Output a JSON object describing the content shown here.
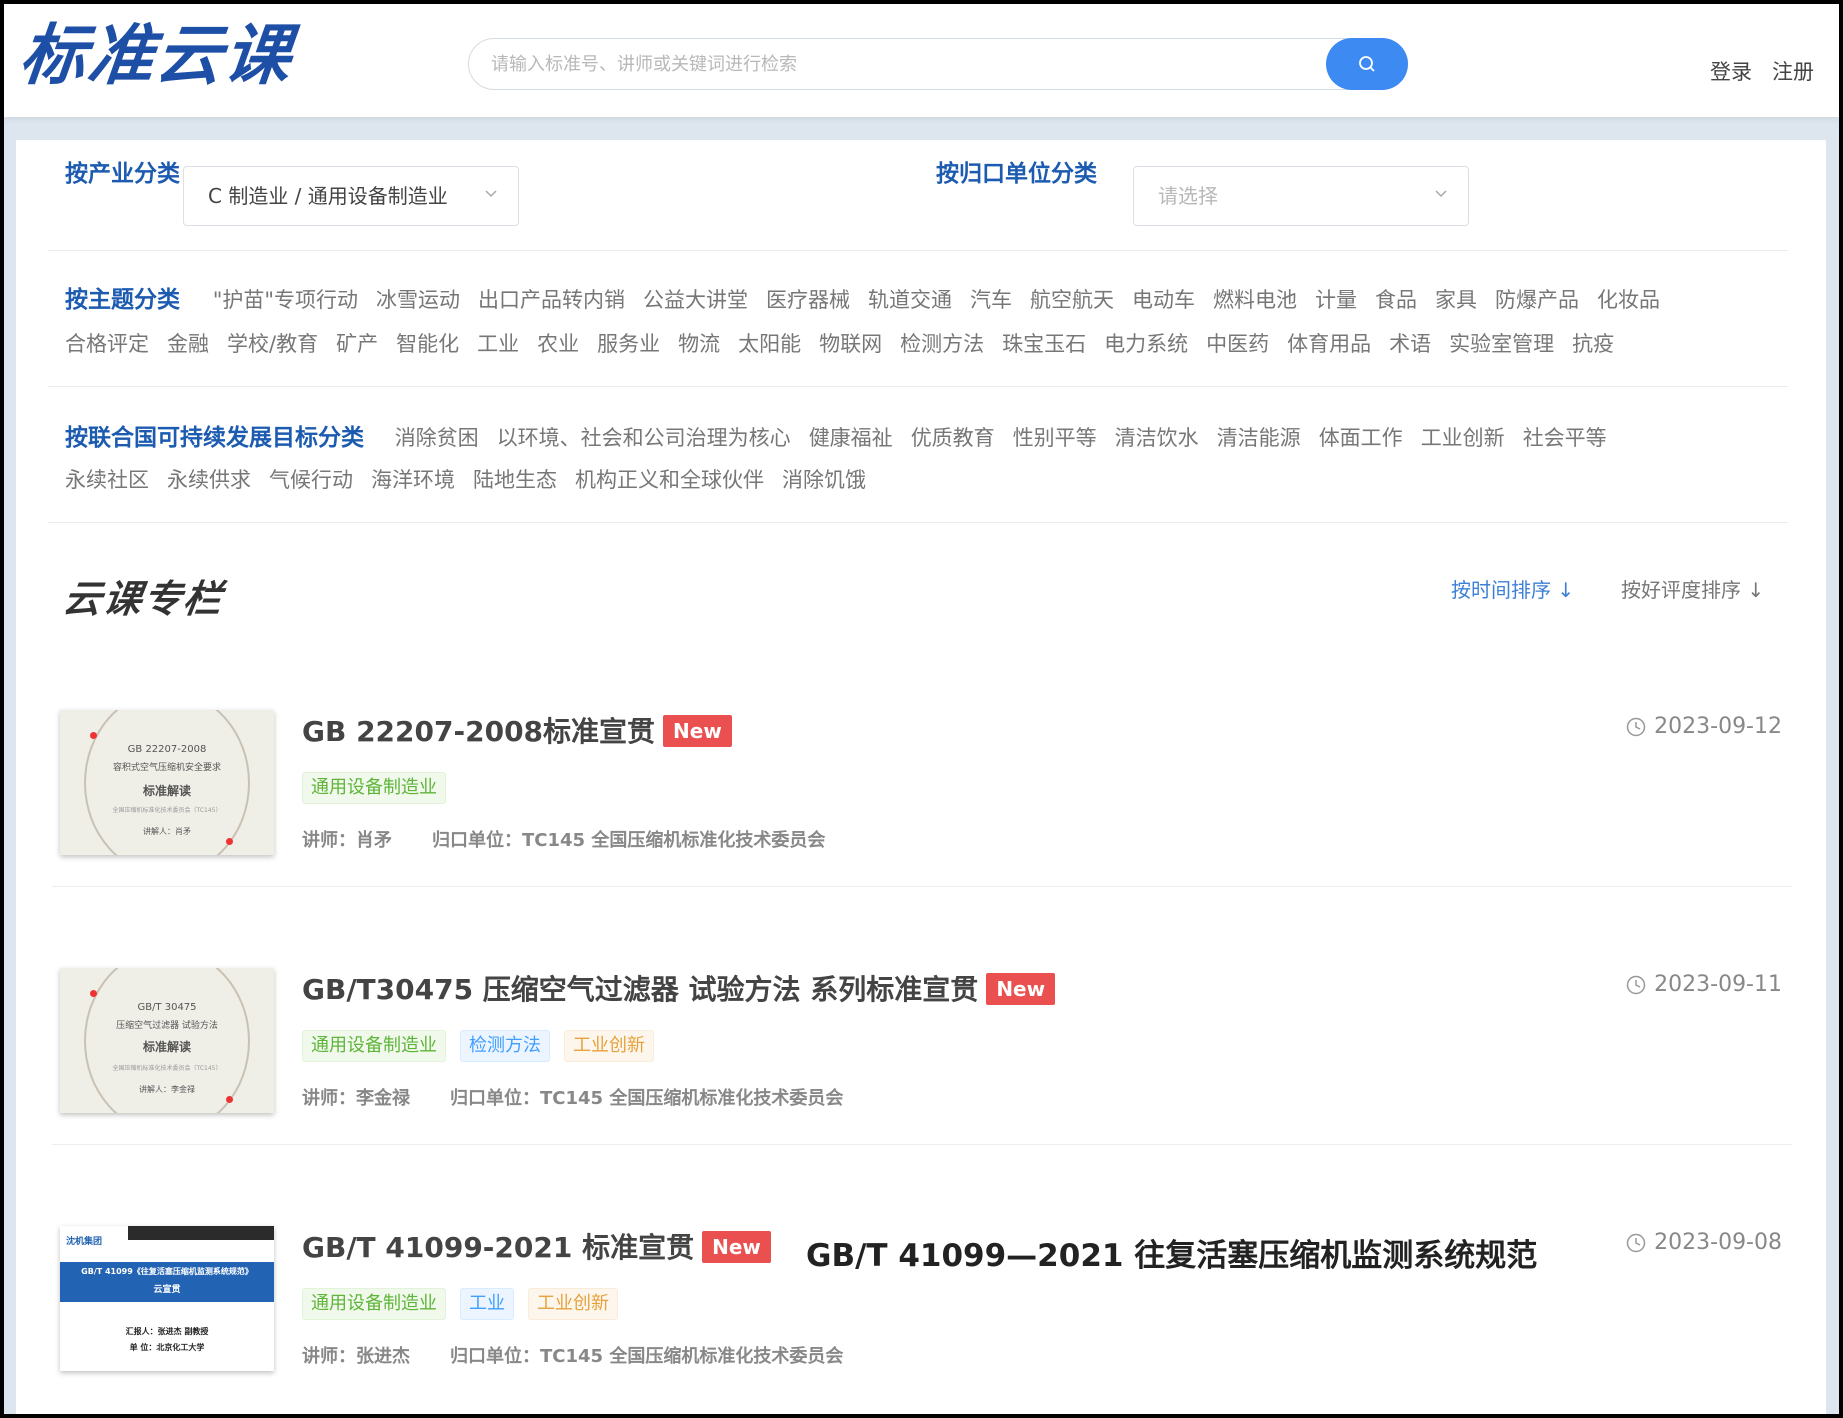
{
  "header": {
    "logo": "标准云课",
    "search_placeholder": "请输入标准号、讲师或关键词进行检索",
    "login": "登录",
    "register": "注册"
  },
  "filters": {
    "industry_label": "按产业分类",
    "industry_value": "C 制造业 / 通用设备制造业",
    "unit_label": "按归口单位分类",
    "unit_placeholder": "请选择"
  },
  "topics": {
    "label": "按主题分类",
    "line1": [
      "\"护苗\"专项行动",
      "冰雪运动",
      "出口产品转内销",
      "公益大讲堂",
      "医疗器械",
      "轨道交通",
      "汽车",
      "航空航天",
      "电动车",
      "燃料电池",
      "计量",
      "食品",
      "家具",
      "防爆产品",
      "化妆品"
    ],
    "line2": [
      "合格评定",
      "金融",
      "学校/教育",
      "矿产",
      "智能化",
      "工业",
      "农业",
      "服务业",
      "物流",
      "太阳能",
      "物联网",
      "检测方法",
      "珠宝玉石",
      "电力系统",
      "中医药",
      "体育用品",
      "术语",
      "实验室管理",
      "抗疫"
    ]
  },
  "sdg": {
    "label": "按联合国可持续发展目标分类",
    "line1": [
      "消除贫困",
      "以环境、社会和公司治理为核心",
      "健康福祉",
      "优质教育",
      "性别平等",
      "清洁饮水",
      "清洁能源",
      "体面工作",
      "工业创新",
      "社会平等"
    ],
    "line2": [
      "永续社区",
      "永续供求",
      "气候行动",
      "海洋环境",
      "陆地生态",
      "机构正义和全球伙伴",
      "消除饥饿"
    ]
  },
  "column": {
    "title": "云课专栏",
    "sort_time": "按时间排序 ↓",
    "sort_rating": "按好评度排序 ↓"
  },
  "courses": [
    {
      "title": "GB 22207-2008标准宣贯",
      "badge": "New",
      "date": "2023-09-12",
      "tags": [
        "通用设备制造业"
      ],
      "lecturer": "讲师：肖矛",
      "unit": "归口单位：TC145 全国压缩机标准化技术委员会",
      "thumb": {
        "l1": "GB 22207-2008",
        "l2": "容积式空气压缩机安全要求",
        "l3": "标准解读",
        "l4": "全国压缩机标准化技术委员会（TC145）",
        "l5": "讲解人：肖矛"
      }
    },
    {
      "title": "GB/T30475 压缩空气过滤器 试验方法 系列标准宣贯",
      "badge": "New",
      "date": "2023-09-11",
      "tags": [
        "通用设备制造业",
        "检测方法",
        "工业创新"
      ],
      "lecturer": "讲师：李金禄",
      "unit": "归口单位：TC145 全国压缩机标准化技术委员会",
      "thumb": {
        "l1": "GB/T 30475",
        "l2": "压缩空气过滤器 试验方法",
        "l3": "标准解读",
        "l4": "全国压缩机标准化技术委员会（TC145）",
        "l5": "讲解人：李金禄"
      }
    },
    {
      "title": "GB/T 41099-2021 标准宣贯",
      "badge": "New",
      "extra_title": "GB/T 41099—2021  往复活塞压缩机监测系统规范",
      "date": "2023-09-08",
      "tags": [
        "通用设备制造业",
        "工业",
        "工业创新"
      ],
      "lecturer": "讲师：张进杰",
      "unit": "归口单位：TC145 全国压缩机标准化技术委员会",
      "thumb": {
        "brand": "沈机集团",
        "l1": "GB/T 41099《往复活塞压缩机监测系统规范》",
        "l2": "云宣贯",
        "l3": "汇报人：张进杰 副教授",
        "l4": "单 位：北京化工大学"
      }
    }
  ],
  "colors": {
    "accent": "#1c5bb0",
    "search_button": "#3d8bf2",
    "new_badge": "#e9504f"
  }
}
